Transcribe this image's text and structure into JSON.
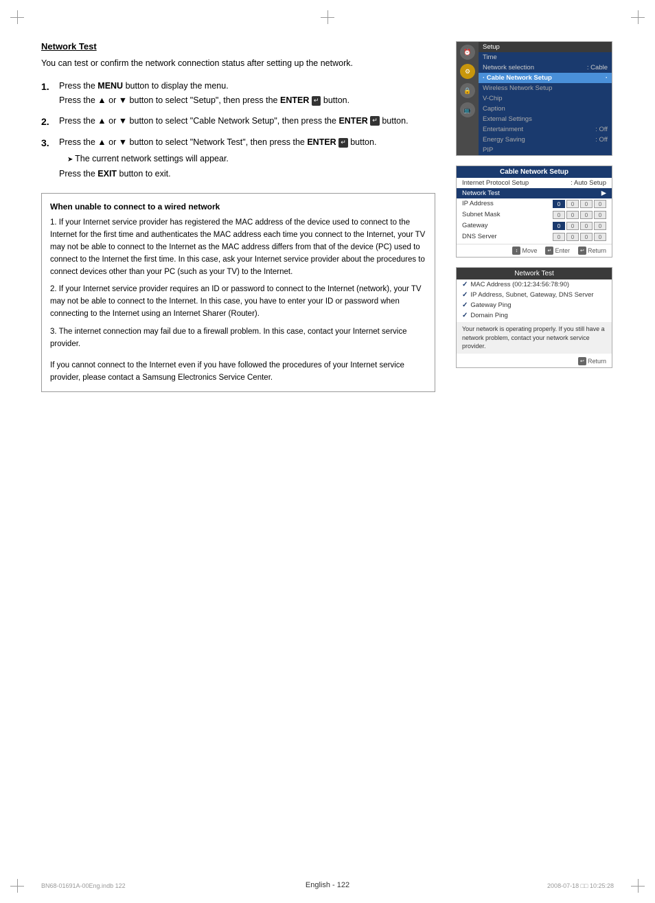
{
  "page": {
    "title": "Network Test",
    "footer_center": "English - 122",
    "footer_left": "BN68-01691A-00Eng.indb   122",
    "footer_right": "2008-07-18   □□ 10:25:28"
  },
  "content": {
    "section_title": "Network Test",
    "intro": "You can test or confirm the network connection status after setting up the network.",
    "steps": [
      {
        "number": "1.",
        "main": "Press the MENU button to display the menu.",
        "sub": "Press the ▲ or ▼ button to select \"Setup\", then press the ENTER ↵ button."
      },
      {
        "number": "2.",
        "main": "Press the ▲ or ▼ button to select \"Cable Network Setup\", then press the ENTER ↵ button."
      },
      {
        "number": "3.",
        "main": "Press the ▲ or ▼ button to select \"Network Test\", then press the ENTER ↵ button.",
        "note1": "➤  The current network settings will appear.",
        "note2": "Press the EXIT button to exit."
      }
    ],
    "warning": {
      "title": "When unable to connect to a wired network",
      "items": [
        "1. If your Internet service provider has registered the MAC address of the device used to connect to the Internet for the first time and authenticates the MAC address each time you connect to the Internet, your TV may not be able to connect to the Internet as the MAC address differs from that of the device (PC) used to connect to the Internet the first time. In this case, ask your Internet service provider about the procedures to connect devices other than your PC (such as your TV) to the Internet.",
        "2. If your Internet service provider requires an ID or password to connect to the Internet (network), your TV may not be able to connect to the Internet. In this case, you have to enter your ID or password when connecting to the Internet using an Internet Sharer (Router).",
        "3. The internet connection may fail due to a firewall problem. In this case, contact your Internet service provider.",
        "If you cannot connect to the Internet even if you have followed the procedures of your Internet service provider, please contact a Samsung Electronics Service Center."
      ]
    }
  },
  "ui_panels": {
    "setup_menu": {
      "title": "Setup",
      "items": [
        {
          "label": "Time",
          "value": ""
        },
        {
          "label": "Network selection",
          "value": ": Cable"
        },
        {
          "label": "Cable Network Setup",
          "highlighted": true
        },
        {
          "label": "Wireless Network Setup",
          "value": ""
        },
        {
          "label": "V-Chip",
          "value": ""
        },
        {
          "label": "Caption",
          "value": ""
        },
        {
          "label": "External Settings",
          "value": ""
        },
        {
          "label": "Entertainment",
          "value": ": Off"
        },
        {
          "label": "Energy Saving",
          "value": ": Off"
        },
        {
          "label": "PIP",
          "value": ""
        }
      ]
    },
    "cable_network_setup": {
      "title": "Cable Network Setup",
      "rows": [
        {
          "label": "Internet Protocol Setup",
          "value": ": Auto Setup"
        },
        {
          "label": "Network Test",
          "highlighted": true
        },
        {
          "label": "IP Address",
          "value": ""
        },
        {
          "label": "Subnet Mask",
          "value": ""
        },
        {
          "label": "Gateway",
          "value": ""
        },
        {
          "label": "DNS Server",
          "value": ""
        }
      ],
      "footer": {
        "move": "Move",
        "enter": "Enter",
        "return": "Return"
      }
    },
    "network_test": {
      "title": "Network Test",
      "items": [
        "MAC Address (00:12:34:56:78:90)",
        "IP Address, Subnet, Gateway, DNS Server",
        "Gateway Ping",
        "Domain Ping"
      ],
      "message": "Your network is operating properly. If you still have a network problem, contact your network service provider.",
      "footer": "Return"
    }
  }
}
